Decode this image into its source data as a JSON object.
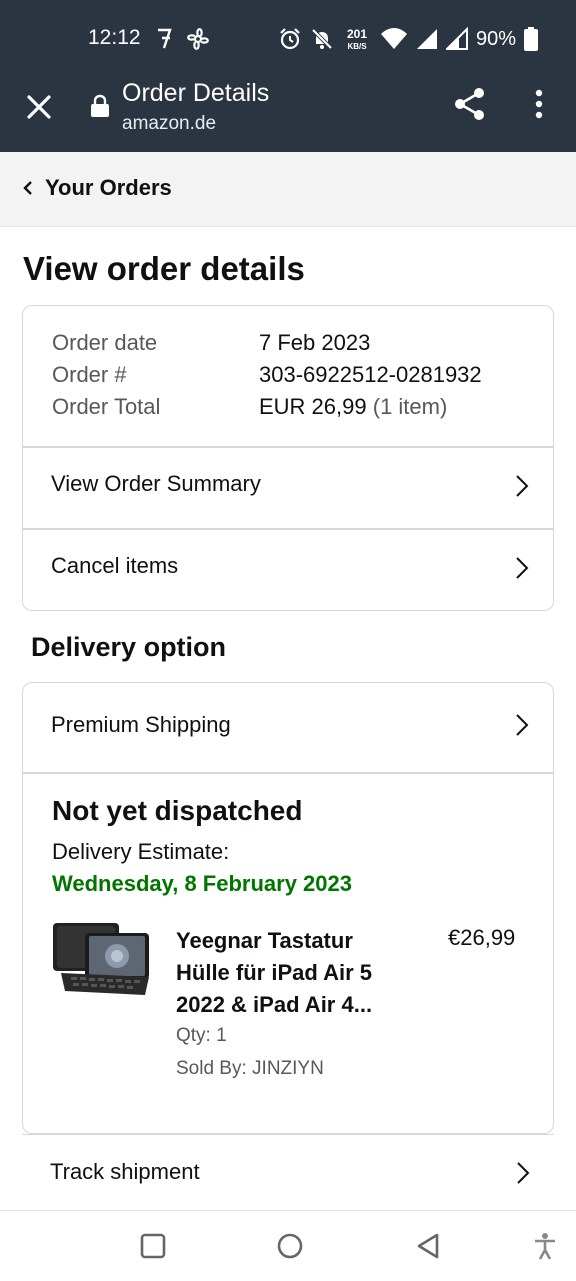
{
  "status_bar": {
    "time": "12:12",
    "net_speed": "201",
    "net_unit": "KB/S",
    "battery_pct": "90%"
  },
  "app_bar": {
    "title": "Order Details",
    "domain": "amazon.de"
  },
  "breadcrumb": {
    "label": "Your Orders"
  },
  "page": {
    "title": "View order details"
  },
  "order": {
    "date_label": "Order date",
    "date_value": "7 Feb 2023",
    "number_label": "Order #",
    "number_value": "303-6922512-0281932",
    "total_label": "Order Total",
    "total_value": "EUR 26,99",
    "total_items": "(1 item)",
    "summary_link": "View Order Summary",
    "cancel_link": "Cancel items"
  },
  "delivery": {
    "section_title": "Delivery option",
    "shipping_option": "Premium Shipping",
    "status": "Not yet dispatched",
    "estimate_label": "Delivery Estimate:",
    "estimate_date": "Wednesday, 8 February 2023",
    "estimate_color": "#007600"
  },
  "product": {
    "title": "Yeegnar Tastatur Hülle für iPad Air 5 2022 & iPad Air 4...",
    "price": "€26,99",
    "qty": "Qty: 1",
    "seller": "Sold By: JINZIYN"
  },
  "track": {
    "label": "Track shipment"
  },
  "colors": {
    "header_bg": "#2b3542",
    "link_green": "#007600",
    "border": "#d5d9d9"
  }
}
